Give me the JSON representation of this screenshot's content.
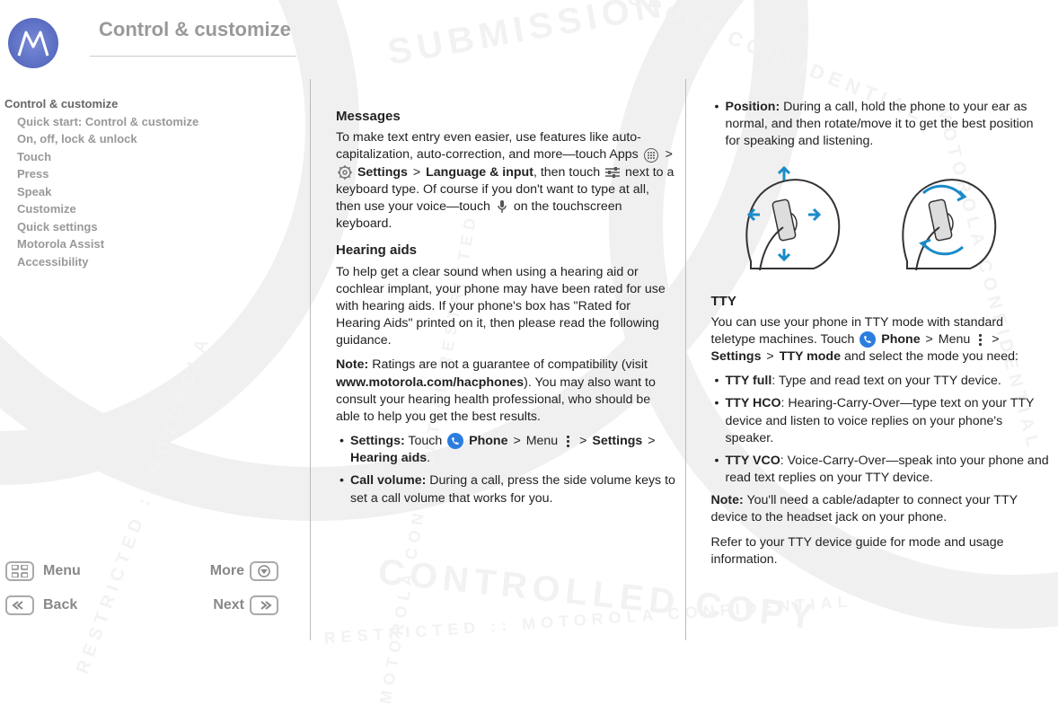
{
  "header": {
    "title": "Control & customize"
  },
  "nav": {
    "root": "Control & customize",
    "items": [
      "Quick start: Control & customize",
      "On, off, lock & unlock",
      "Touch",
      "Press",
      "Speak",
      "Customize",
      "Quick settings",
      "Motorola Assist",
      "Accessibility"
    ]
  },
  "footer": {
    "menu": "Menu",
    "more": "More",
    "back": "Back",
    "next": "Next"
  },
  "col1": {
    "messages": {
      "heading": "Messages",
      "p1a": "To make text entry even easier, use features like auto-capitalization, auto-correction, and more—touch Apps ",
      "p1_settings": "Settings",
      "p1_lang": "Language & input",
      "p1b": ", then touch ",
      "p1c": " next to a keyboard type. Of course if you don't want to type at all, then use your voice—touch ",
      "p1d": " on the touchscreen keyboard."
    },
    "hearing": {
      "heading": "Hearing aids",
      "p1": "To help get a clear sound when using a hearing aid or cochlear implant, your phone may have been rated for use with hearing aids. If your phone's box has \"Rated for Hearing Aids\" printed on it, then please read the following guidance.",
      "note_label": "Note:",
      "note_a": " Ratings are not a guarantee of compatibility (visit ",
      "note_url": "www.motorola.com/hacphones",
      "note_b": "). You may also want to consult your hearing health professional, who should be able to help you get the best results.",
      "li_settings_label": "Settings:",
      "li_settings_a": " Touch ",
      "phone_label": "Phone",
      "menu_label": "Menu",
      "settings_label": "Settings",
      "hearing_aids_label": "Hearing aids",
      "li_callvol_label": "Call volume:",
      "li_callvol_text": " During a call, press the side volume keys to set a call volume that works for you."
    }
  },
  "col2": {
    "position": {
      "label": "Position:",
      "text": " During a call, hold the phone to your ear as normal, and then rotate/move it to get the best position for speaking and listening."
    },
    "tty": {
      "heading": "TTY",
      "p1a": "You can use your phone in TTY mode with standard teletype machines. Touch ",
      "phone_label": "Phone",
      "menu_label": "Menu",
      "settings_label": "Settings",
      "tty_mode_label": "TTY mode",
      "p1b": " and select the mode you need:",
      "li_full_label": "TTY full",
      "li_full_text": ": Type and read text on your TTY device.",
      "li_hco_label": "TTY HCO",
      "li_hco_text": ": Hearing-Carry-Over—type text on your TTY device and listen to voice replies on your phone's speaker.",
      "li_vco_label": "TTY VCO",
      "li_vco_text": ": Voice-Carry-Over—speak into your phone and read text replies on your TTY device.",
      "note_label": "Note:",
      "note_text": " You'll need a cable/adapter to connect your TTY device to the headset jack on your phone.",
      "p_refer": "Refer to your TTY device guide for mode and usage information."
    }
  },
  "glyphs": {
    "arrow": ">"
  }
}
